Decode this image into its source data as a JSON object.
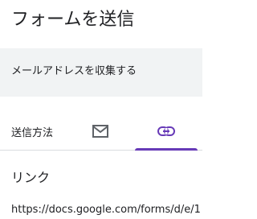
{
  "dialog": {
    "title": "フォームを送信"
  },
  "collect_email": {
    "label": "メールアドレスを収集する"
  },
  "send_via": {
    "label": "送信方法",
    "tabs": [
      {
        "icon": "email-icon",
        "selected": false
      },
      {
        "icon": "link-icon",
        "selected": true
      }
    ]
  },
  "link_section": {
    "heading": "リンク",
    "url": "https://docs.google.com/forms/d/e/1"
  },
  "colors": {
    "accent": "#673ab7",
    "icon": "#5f6368",
    "row_background": "#f1f3f4",
    "divider": "#dadce0",
    "text": "#202124"
  }
}
